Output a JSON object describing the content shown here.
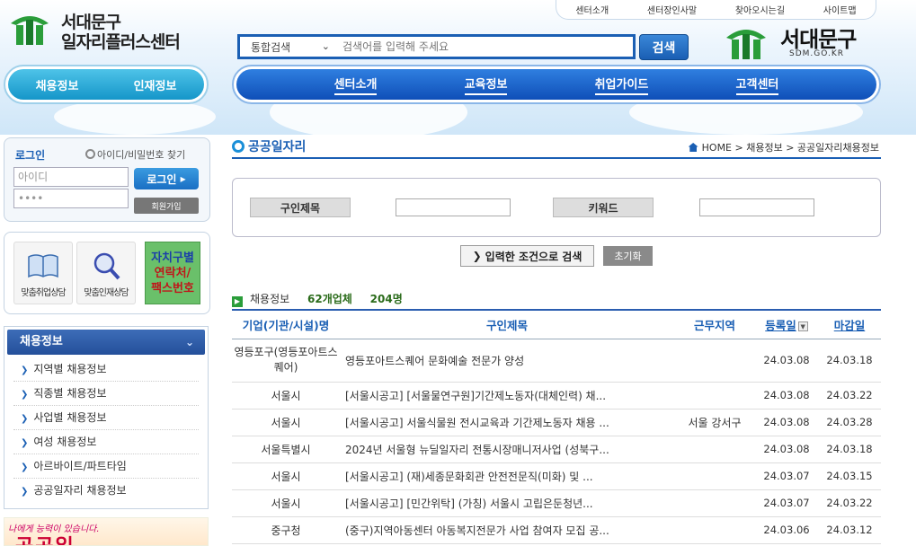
{
  "header": {
    "center_name_line1": "서대문구",
    "center_name_line2": "일자리플러스센터",
    "top_links": [
      "센터소개",
      "센터장인사말",
      "찾아오시는길",
      "사이트맵"
    ],
    "search": {
      "scope": "통합검색",
      "placeholder": "검색어를 입력해 주세요",
      "button": "검색"
    },
    "district": {
      "name": "서대문구",
      "url": "SDM.GO.KR"
    }
  },
  "left_nav": [
    "채용정보",
    "인재정보"
  ],
  "main_nav": [
    "센터소개",
    "교육정보",
    "취업가이드",
    "고객센터"
  ],
  "login": {
    "title": "로그인",
    "find": "아이디/비밀번호 찾기",
    "id_placeholder": "아이디",
    "pw_value": "••••",
    "login_button": "로그인",
    "join_button": "회원가입"
  },
  "quick": {
    "job_consult": "맞춤취업상담",
    "talent_consult": "맞춤인재상담",
    "directory_lines": [
      "자치구별",
      "연락처/",
      "팩스번호"
    ]
  },
  "sidemenu": {
    "title": "채용정보",
    "items": [
      "지역별 채용정보",
      "직종별 채용정보",
      "사업별 채용정보",
      "여성 채용정보",
      "아르바이트/파트타임",
      "공공일자리 채용정보"
    ]
  },
  "banner": {
    "line1": "나에게 능력이 있습니다.",
    "line2": "공공일"
  },
  "page": {
    "title": "공공일자리",
    "breadcrumb": "HOME > 채용정보 > 공공일자리채용정보"
  },
  "filters": {
    "label1": "구인제목",
    "label2": "키워드",
    "search_button": "입력한 조건으로 검색",
    "reset_button": "초기화"
  },
  "summary": {
    "label": "채용정보",
    "companies": "62개업체",
    "people": "204명"
  },
  "table": {
    "headers": [
      "기업(기관/시설)명",
      "구인제목",
      "근무지역",
      "등록일",
      "마감일"
    ],
    "rows": [
      {
        "company": "영등포구(영등포아트스퀘어)",
        "title": "영등포아트스퀘어 문화예술 전문가 양성",
        "region": "",
        "reg": "24.03.08",
        "due": "24.03.18"
      },
      {
        "company": "서울시",
        "title": "[서울시공고] [서울물연구원]기간제노동자(대체인력) 채...",
        "region": "",
        "reg": "24.03.08",
        "due": "24.03.22"
      },
      {
        "company": "서울시",
        "title": "[서울시공고] 서울식물원 전시교육과 기간제노동자 채용 ...",
        "region": "서울 강서구",
        "reg": "24.03.08",
        "due": "24.03.28"
      },
      {
        "company": "서울특별시",
        "title": "2024년 서울형 뉴딜일자리 전통시장매니저사업 (성북구...",
        "region": "",
        "reg": "24.03.08",
        "due": "24.03.18"
      },
      {
        "company": "서울시",
        "title": "[서울시공고] (재)세종문화회관 안전전문직(미화) 및 ...",
        "region": "",
        "reg": "24.03.07",
        "due": "24.03.15"
      },
      {
        "company": "서울시",
        "title": "[서울시공고] [민간위탁] (가칭) 서울시 고립은둔청년...",
        "region": "",
        "reg": "24.03.07",
        "due": "24.03.22"
      },
      {
        "company": "중구청",
        "title": "(중구)지역아동센터 아동복지전문가 사업 참여자 모집 공...",
        "region": "",
        "reg": "24.03.06",
        "due": "24.03.12"
      }
    ]
  }
}
